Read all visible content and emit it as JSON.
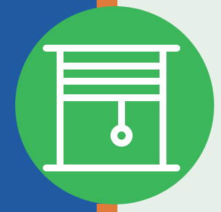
{
  "colors": {
    "left_panel": "#1f5aa3",
    "right_panel": "#e6efe8",
    "accent": "#e07a3b",
    "badge": "#3cb65a",
    "icon_stroke": "#ffffff"
  },
  "icon": {
    "name": "window-roller-blind-icon"
  }
}
